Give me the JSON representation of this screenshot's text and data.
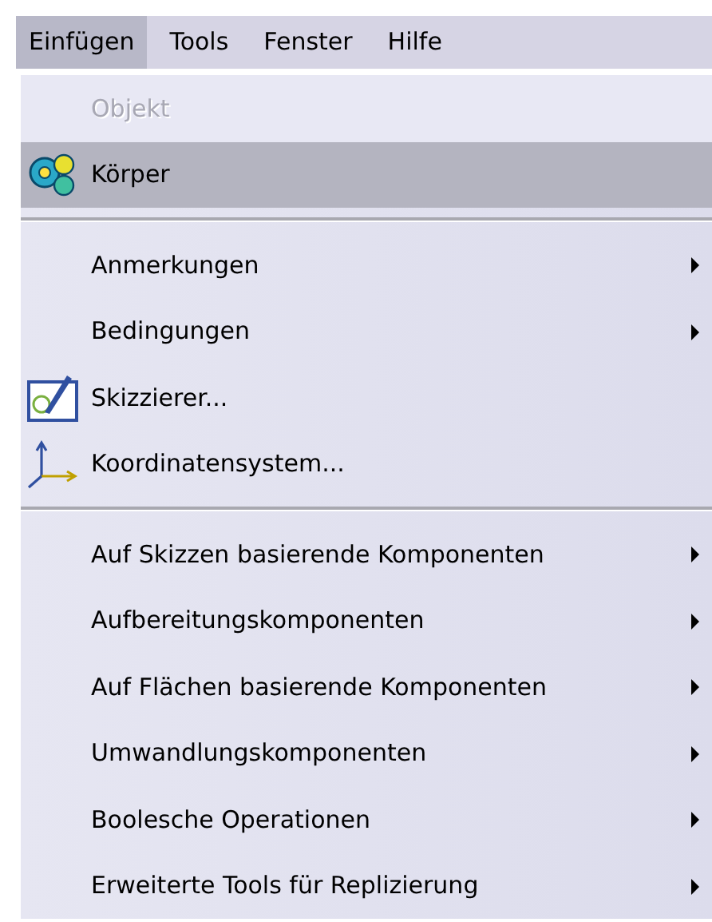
{
  "menubar": [
    {
      "label": "Einfügen",
      "selected": true
    },
    {
      "label": "Tools",
      "selected": false
    },
    {
      "label": "Fenster",
      "selected": false
    },
    {
      "label": "Hilfe",
      "selected": false
    }
  ],
  "menu": {
    "groups": [
      [
        {
          "label": "Objekt",
          "disabled": true,
          "selected": false,
          "submenu": false
        },
        {
          "label": "Körper",
          "disabled": false,
          "selected": true,
          "submenu": false,
          "kind": "body"
        }
      ],
      [
        {
          "label": "Anmerkungen",
          "disabled": false,
          "selected": false,
          "submenu": true
        },
        {
          "label": "Bedingungen",
          "disabled": false,
          "selected": false,
          "submenu": true
        },
        {
          "label": "Skizzierer...",
          "disabled": false,
          "selected": false,
          "submenu": false,
          "kind": "sketch"
        },
        {
          "label": "Koordinatensystem...",
          "disabled": false,
          "selected": false,
          "submenu": false,
          "kind": "axis"
        }
      ],
      [
        {
          "label": "Auf Skizzen basierende Komponenten",
          "disabled": false,
          "selected": false,
          "submenu": true
        },
        {
          "label": "Aufbereitungskomponenten",
          "disabled": false,
          "selected": false,
          "submenu": true
        },
        {
          "label": "Auf Flächen basierende Komponenten",
          "disabled": false,
          "selected": false,
          "submenu": true
        },
        {
          "label": "Umwandlungskomponenten",
          "disabled": false,
          "selected": false,
          "submenu": true
        },
        {
          "label": "Boolesche Operationen",
          "disabled": false,
          "selected": false,
          "submenu": true
        },
        {
          "label": "Erweiterte Tools für Replizierung",
          "disabled": false,
          "selected": false,
          "submenu": true
        }
      ]
    ]
  }
}
